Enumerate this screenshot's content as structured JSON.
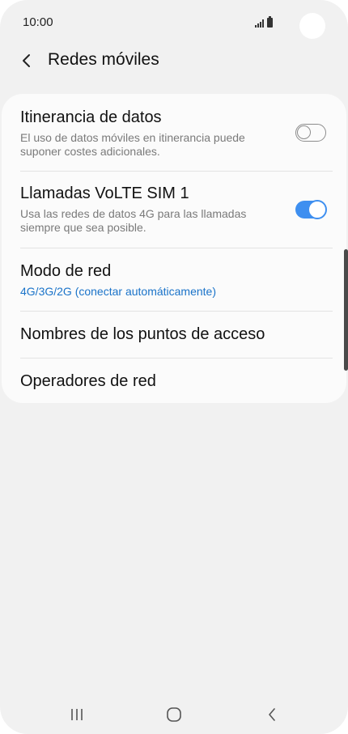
{
  "status_bar": {
    "time": "10:00",
    "icons": [
      "signal-icon",
      "battery-icon"
    ]
  },
  "header": {
    "back_icon": "chevron-left-icon",
    "title": "Redes móviles"
  },
  "settings": {
    "data_roaming": {
      "title": "Itinerancia de datos",
      "description": "El uso de datos móviles en itinerancia puede suponer costes adicionales.",
      "enabled": false
    },
    "volte": {
      "title": "Llamadas VoLTE SIM 1",
      "description": "Usa las redes de datos 4G para las llamadas siempre que sea posible.",
      "enabled": true
    },
    "network_mode": {
      "title": "Modo de red",
      "value": "4G/3G/2G (conectar automáticamente)"
    },
    "access_point_names": {
      "title": "Nombres de los puntos de acceso"
    },
    "network_operators": {
      "title": "Operadores de red"
    }
  },
  "nav_bar": {
    "recents_icon": "recents-icon",
    "home_icon": "home-icon",
    "back_icon": "back-icon"
  },
  "colors": {
    "background": "#f1f1f1",
    "card": "#fbfbfb",
    "accent": "#3e8ff0",
    "link_value": "#1a73c9",
    "subtext": "#7a7a7a"
  }
}
